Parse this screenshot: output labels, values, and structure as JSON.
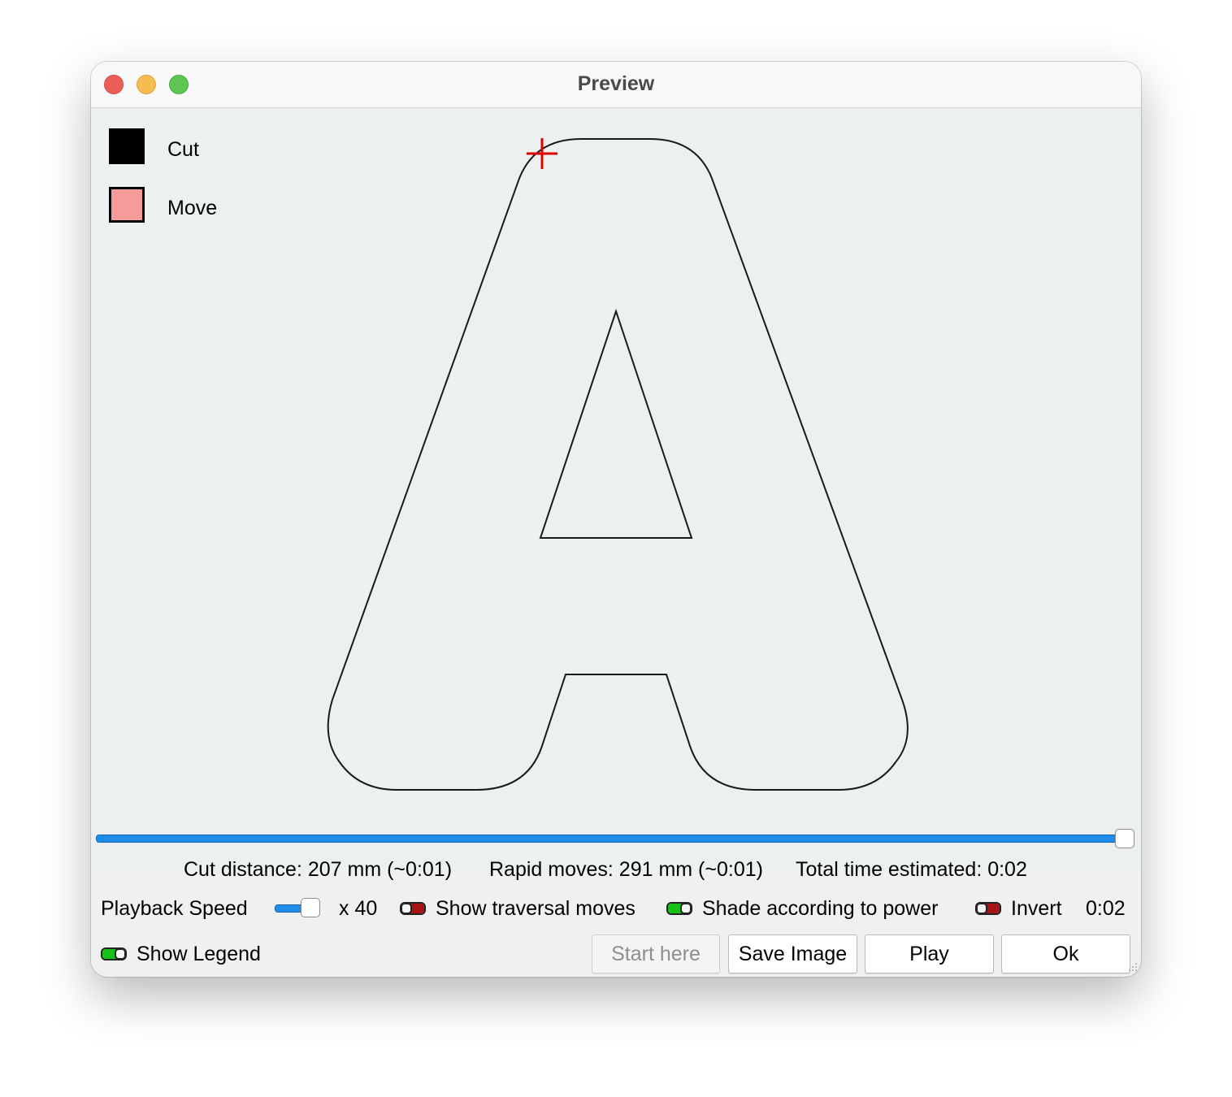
{
  "window": {
    "title": "Preview"
  },
  "legend": {
    "items": [
      {
        "label": "Cut",
        "color": "#000000"
      },
      {
        "label": "Move",
        "color": "#f79a9a"
      }
    ]
  },
  "colors": {
    "path_stroke": "#1a1a1a",
    "start_marker": "#e00000",
    "canvas_bg": "#ecf0f1",
    "slider_accent": "#1f8cea",
    "toggle_on": "#17c117",
    "toggle_off": "#a51515"
  },
  "playback": {
    "position_fraction": 1.0
  },
  "stats": {
    "cut_distance": "Cut distance: 207 mm (~0:01)",
    "rapid_moves": "Rapid moves: 291 mm (~0:01)",
    "total_time": "Total time estimated: 0:02"
  },
  "controls": {
    "playback_speed_label": "Playback Speed",
    "speed_multiplier": "x 40",
    "show_traversal_label": "Show traversal moves",
    "show_traversal_on": false,
    "shade_power_label": "Shade according to power",
    "shade_power_on": true,
    "invert_label": "Invert",
    "invert_on": false,
    "elapsed_time": "0:02",
    "show_legend_label": "Show Legend",
    "show_legend_on": true
  },
  "buttons": {
    "start_here": "Start here",
    "save_image": "Save Image",
    "play": "Play",
    "ok": "Ok"
  },
  "icons": {
    "start_marker": "crosshair-icon",
    "resize": "resize-grip-icon"
  }
}
